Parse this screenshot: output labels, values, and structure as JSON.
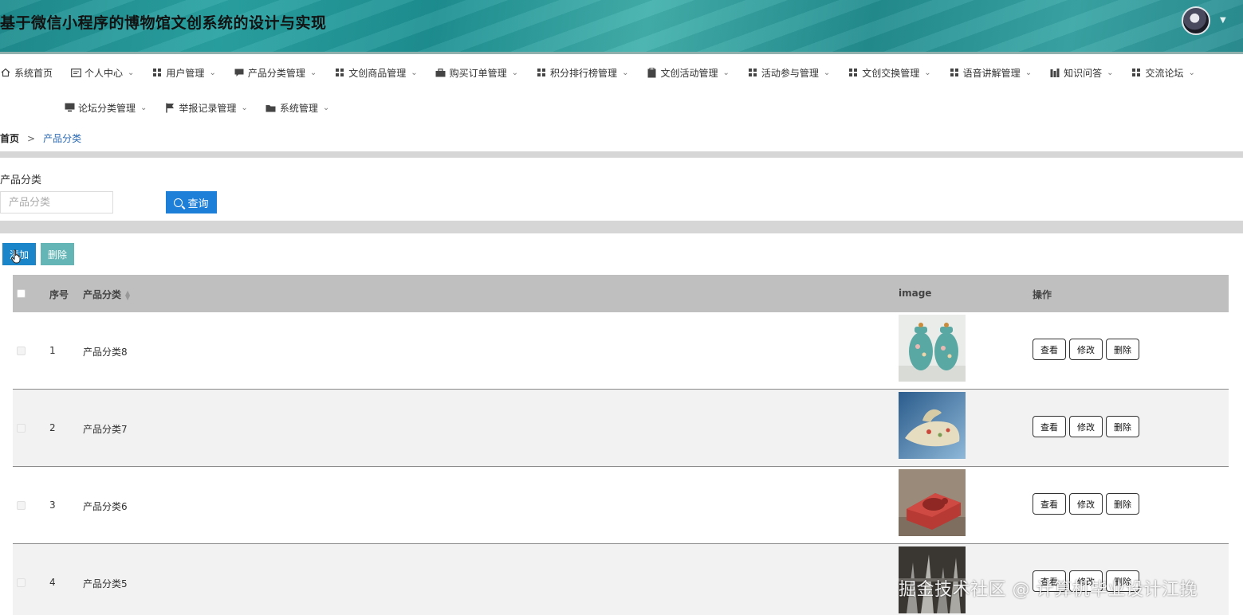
{
  "header": {
    "title": "基于微信小程序的博物馆文创系统的设计与实现"
  },
  "nav": {
    "row1": [
      {
        "label": "系统首页",
        "icon": "home-icon",
        "caret": false
      },
      {
        "label": "个人中心",
        "icon": "id-card-icon",
        "caret": true
      },
      {
        "label": "用户管理",
        "icon": "grid-icon",
        "caret": true
      },
      {
        "label": "产品分类管理",
        "icon": "comment-icon",
        "caret": true
      },
      {
        "label": "文创商品管理",
        "icon": "grid-icon",
        "caret": true
      },
      {
        "label": "购买订单管理",
        "icon": "briefcase-icon",
        "caret": true
      },
      {
        "label": "积分排行榜管理",
        "icon": "grid-icon",
        "caret": true
      },
      {
        "label": "文创活动管理",
        "icon": "clipboard-icon",
        "caret": true
      },
      {
        "label": "活动参与管理",
        "icon": "grid-icon",
        "caret": true
      },
      {
        "label": "文创交换管理",
        "icon": "grid-icon",
        "caret": true
      },
      {
        "label": "语音讲解管理",
        "icon": "grid-icon",
        "caret": true
      },
      {
        "label": "知识问答",
        "icon": "bar-chart-icon",
        "caret": true
      },
      {
        "label": "交流论坛",
        "icon": "grid-icon",
        "caret": true
      }
    ],
    "row2": [
      {
        "label": "论坛分类管理",
        "icon": "monitor-icon",
        "caret": true
      },
      {
        "label": "举报记录管理",
        "icon": "flag-icon",
        "caret": true
      },
      {
        "label": "系统管理",
        "icon": "folder-icon",
        "caret": true
      }
    ]
  },
  "breadcrumb": {
    "home": "首页",
    "separator": ">",
    "current": "产品分类"
  },
  "search": {
    "label": "产品分类",
    "placeholder": "产品分类",
    "value": "",
    "button": "查询"
  },
  "actions": {
    "add": "添加",
    "delete": "删除"
  },
  "table": {
    "columns": {
      "index": "序号",
      "category": "产品分类",
      "image": "image",
      "ops": "操作"
    },
    "rows": [
      {
        "index": "1",
        "category": "产品分类8",
        "image": "teal-porcelain-jars"
      },
      {
        "index": "2",
        "category": "产品分类7",
        "image": "jade-dragon-carving"
      },
      {
        "index": "3",
        "category": "产品分类6",
        "image": "red-beetle-carving"
      },
      {
        "index": "4",
        "category": "产品分类5",
        "image": "metal-sculpture"
      }
    ],
    "op_labels": {
      "view": "查看",
      "edit": "修改",
      "delete": "删除"
    }
  },
  "watermark": "掘金技术社区 @ 计算机毕业设计江挽",
  "colors": {
    "header_teal": "#1f8d8f",
    "primary_blue": "#1e7fd9",
    "add_blue": "#1a85c8",
    "delete_teal": "#64b5b5",
    "table_header": "#bfbfbf",
    "breadcrumb_link": "#2b6bb5"
  }
}
